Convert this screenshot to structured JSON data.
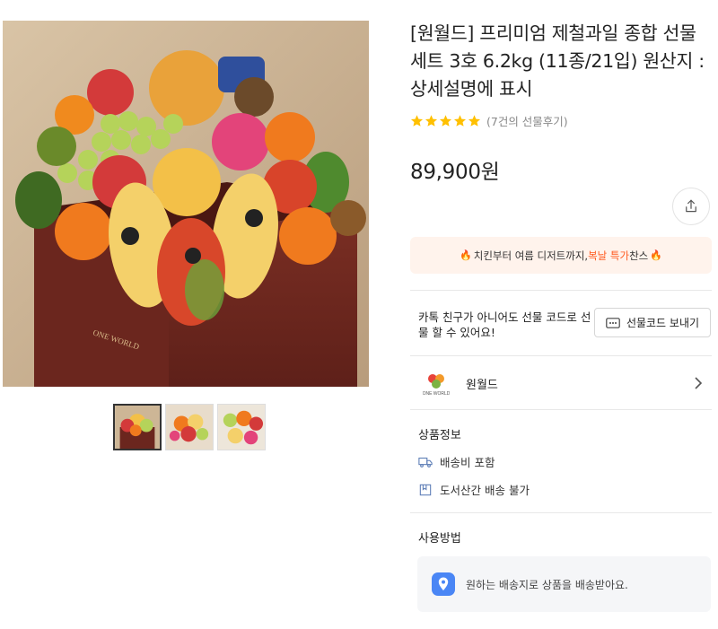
{
  "product": {
    "title": "[원월드] 프리미엄 제철과일 종합 선물세트 3호 6.2kg (11종/21입) 원산지 : 상세설명에 표시",
    "rating_count_text": "(7건의 선물후기)",
    "stars": 5,
    "price": "89,900원",
    "box_brand": "ONE WORLD"
  },
  "banner": {
    "pre": "치킨부터 여름 디저트까지, ",
    "highlight": "복날 특가",
    "post": " 찬스"
  },
  "gift": {
    "description": "카톡 친구가 아니어도 선물 코드로 선물 할 수 있어요!",
    "button_label": "선물코드 보내기"
  },
  "seller": {
    "name": "원월드",
    "logo_text": "ONE WORLD"
  },
  "product_info": {
    "heading": "상품정보",
    "items": [
      {
        "icon": "truck-icon",
        "text": "배송비 포함"
      },
      {
        "icon": "bookmark-icon",
        "text": "도서산간 배송 불가"
      }
    ]
  },
  "usage": {
    "heading": "사용방법",
    "text": "원하는 배송지로 상품을 배송받아요."
  },
  "colors": {
    "star": "#ffc000",
    "accent": "#ff5a1f",
    "banner_bg": "#fff3ec",
    "location_icon": "#4a86f5"
  }
}
